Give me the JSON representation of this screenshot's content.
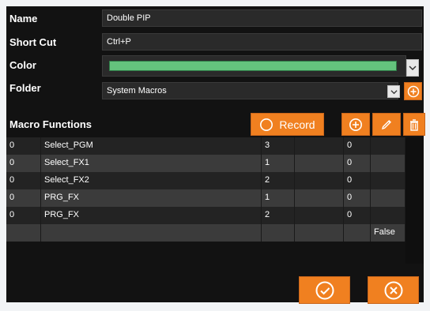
{
  "form": {
    "name_label": "Name",
    "name_value": "Double PIP",
    "shortcut_label": "Short Cut",
    "shortcut_value": "Ctrl+P",
    "color_label": "Color",
    "color_value": "#64c37d",
    "folder_label": "Folder",
    "folder_value": "System Macros"
  },
  "macro": {
    "section_label": "Macro Functions",
    "record_label": "Record",
    "add_icon": "plus-circle-icon",
    "edit_icon": "pencil-icon",
    "delete_icon": "trash-icon"
  },
  "table": {
    "rows": [
      [
        "0",
        "Select_PGM",
        "3",
        "",
        "0",
        ""
      ],
      [
        "0",
        "Select_FX1",
        "1",
        "",
        "0",
        ""
      ],
      [
        "0",
        "Select_FX2",
        "2",
        "",
        "0",
        ""
      ],
      [
        "0",
        "PRG_FX",
        "1",
        "",
        "0",
        ""
      ],
      [
        "0",
        "PRG_FX",
        "2",
        "",
        "0",
        ""
      ],
      [
        "",
        "",
        "",
        "",
        "",
        "False"
      ]
    ]
  },
  "footer": {
    "ok_icon": "check-circle-icon",
    "cancel_icon": "x-circle-icon"
  },
  "colors": {
    "accent_orange": "#f08020",
    "bg_dark": "#121212"
  }
}
